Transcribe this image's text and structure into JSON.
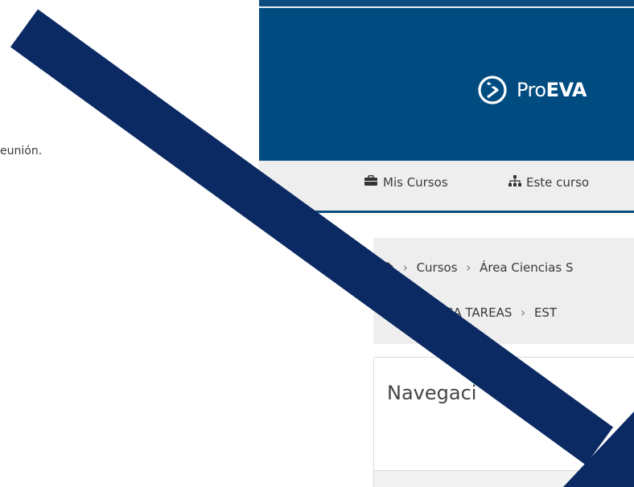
{
  "left_page": {
    "text_fragment": "eunión."
  },
  "brand": {
    "name_light": "Pro",
    "name_bold": "EVA"
  },
  "navbar": {
    "items": [
      {
        "icon": "briefcase-icon",
        "label": "Mis Cursos"
      },
      {
        "icon": "sitemap-icon",
        "label": "Este curso"
      }
    ]
  },
  "breadcrumb": {
    "line1": [
      "Cursos",
      "Área Ciencias S"
    ],
    "line2": [
      "PRACTICA TAREAS",
      "EST"
    ]
  },
  "navigation_block": {
    "title": "Navegaci"
  },
  "colors": {
    "header_blue": "#004c81",
    "arrow_navy": "#0b2a63",
    "navbar_gray": "#eeeeee"
  }
}
